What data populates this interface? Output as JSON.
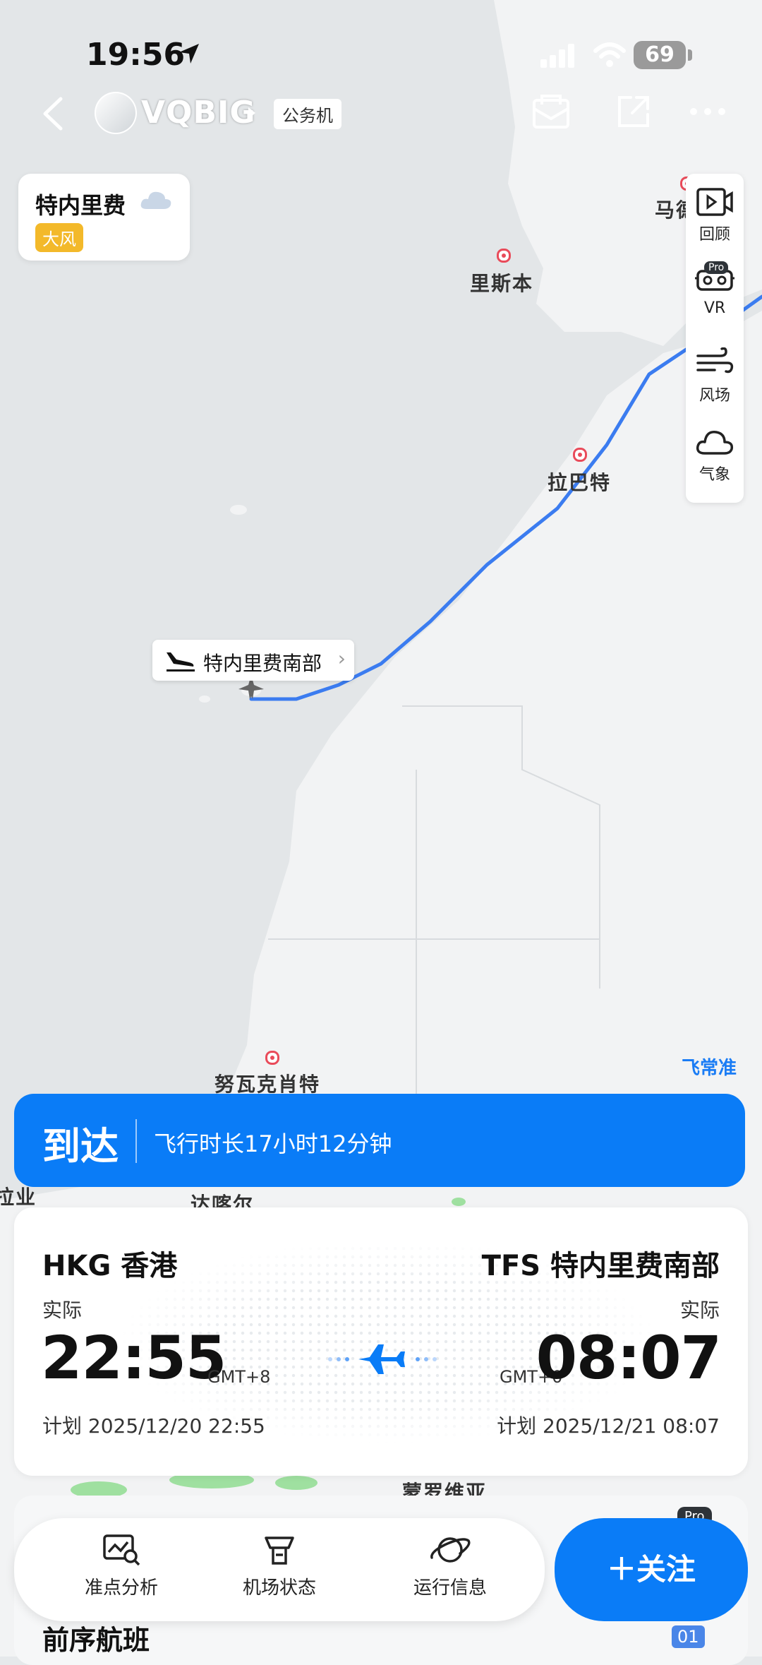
{
  "status_bar": {
    "time": "19:56",
    "battery": "69"
  },
  "header": {
    "flight_no": "VQBIG",
    "tag": "公务机"
  },
  "weather": {
    "city": "特内里费",
    "alert": "大风"
  },
  "tools": [
    {
      "label": "回顾",
      "icon": "replay-icon"
    },
    {
      "label": "VR",
      "icon": "vr-headset-icon",
      "badge": "Pro"
    },
    {
      "label": "风场",
      "icon": "wind-icon"
    },
    {
      "label": "气象",
      "icon": "cloud-icon"
    }
  ],
  "map": {
    "cities": [
      "马德",
      "里斯本",
      "拉巴特",
      "努瓦克肖特",
      "拉业",
      "达喀尔",
      "蒙罗维亚"
    ],
    "plane_label": "特内里费南部",
    "watermark": "飞常准"
  },
  "status": {
    "label": "到达",
    "duration": "飞行时长17小时12分钟"
  },
  "departure": {
    "code": "HKG 香港",
    "kind": "实际",
    "time": "22:55",
    "tz": "GMT+8",
    "plan": "计划 2025/12/20 22:55"
  },
  "arrival": {
    "code": "TFS 特内里费南部",
    "kind": "实际",
    "time": "08:07",
    "tz": "GMT+0",
    "plan": "计划 2025/12/21 08:07"
  },
  "actions": [
    {
      "label": "准点分析",
      "icon": "punctuality-chart-icon"
    },
    {
      "label": "机场状态",
      "icon": "control-tower-icon"
    },
    {
      "label": "运行信息",
      "icon": "planet-icon"
    }
  ],
  "follow": {
    "label": "＋关注",
    "badge": "Pro"
  },
  "bottom": {
    "section_title": "前序航班",
    "page_badge": "01"
  },
  "colors": {
    "accent": "#0a7cf7",
    "route": "#3b7cf0",
    "marker": "#e94b5a",
    "alert": "#f3b92a"
  }
}
